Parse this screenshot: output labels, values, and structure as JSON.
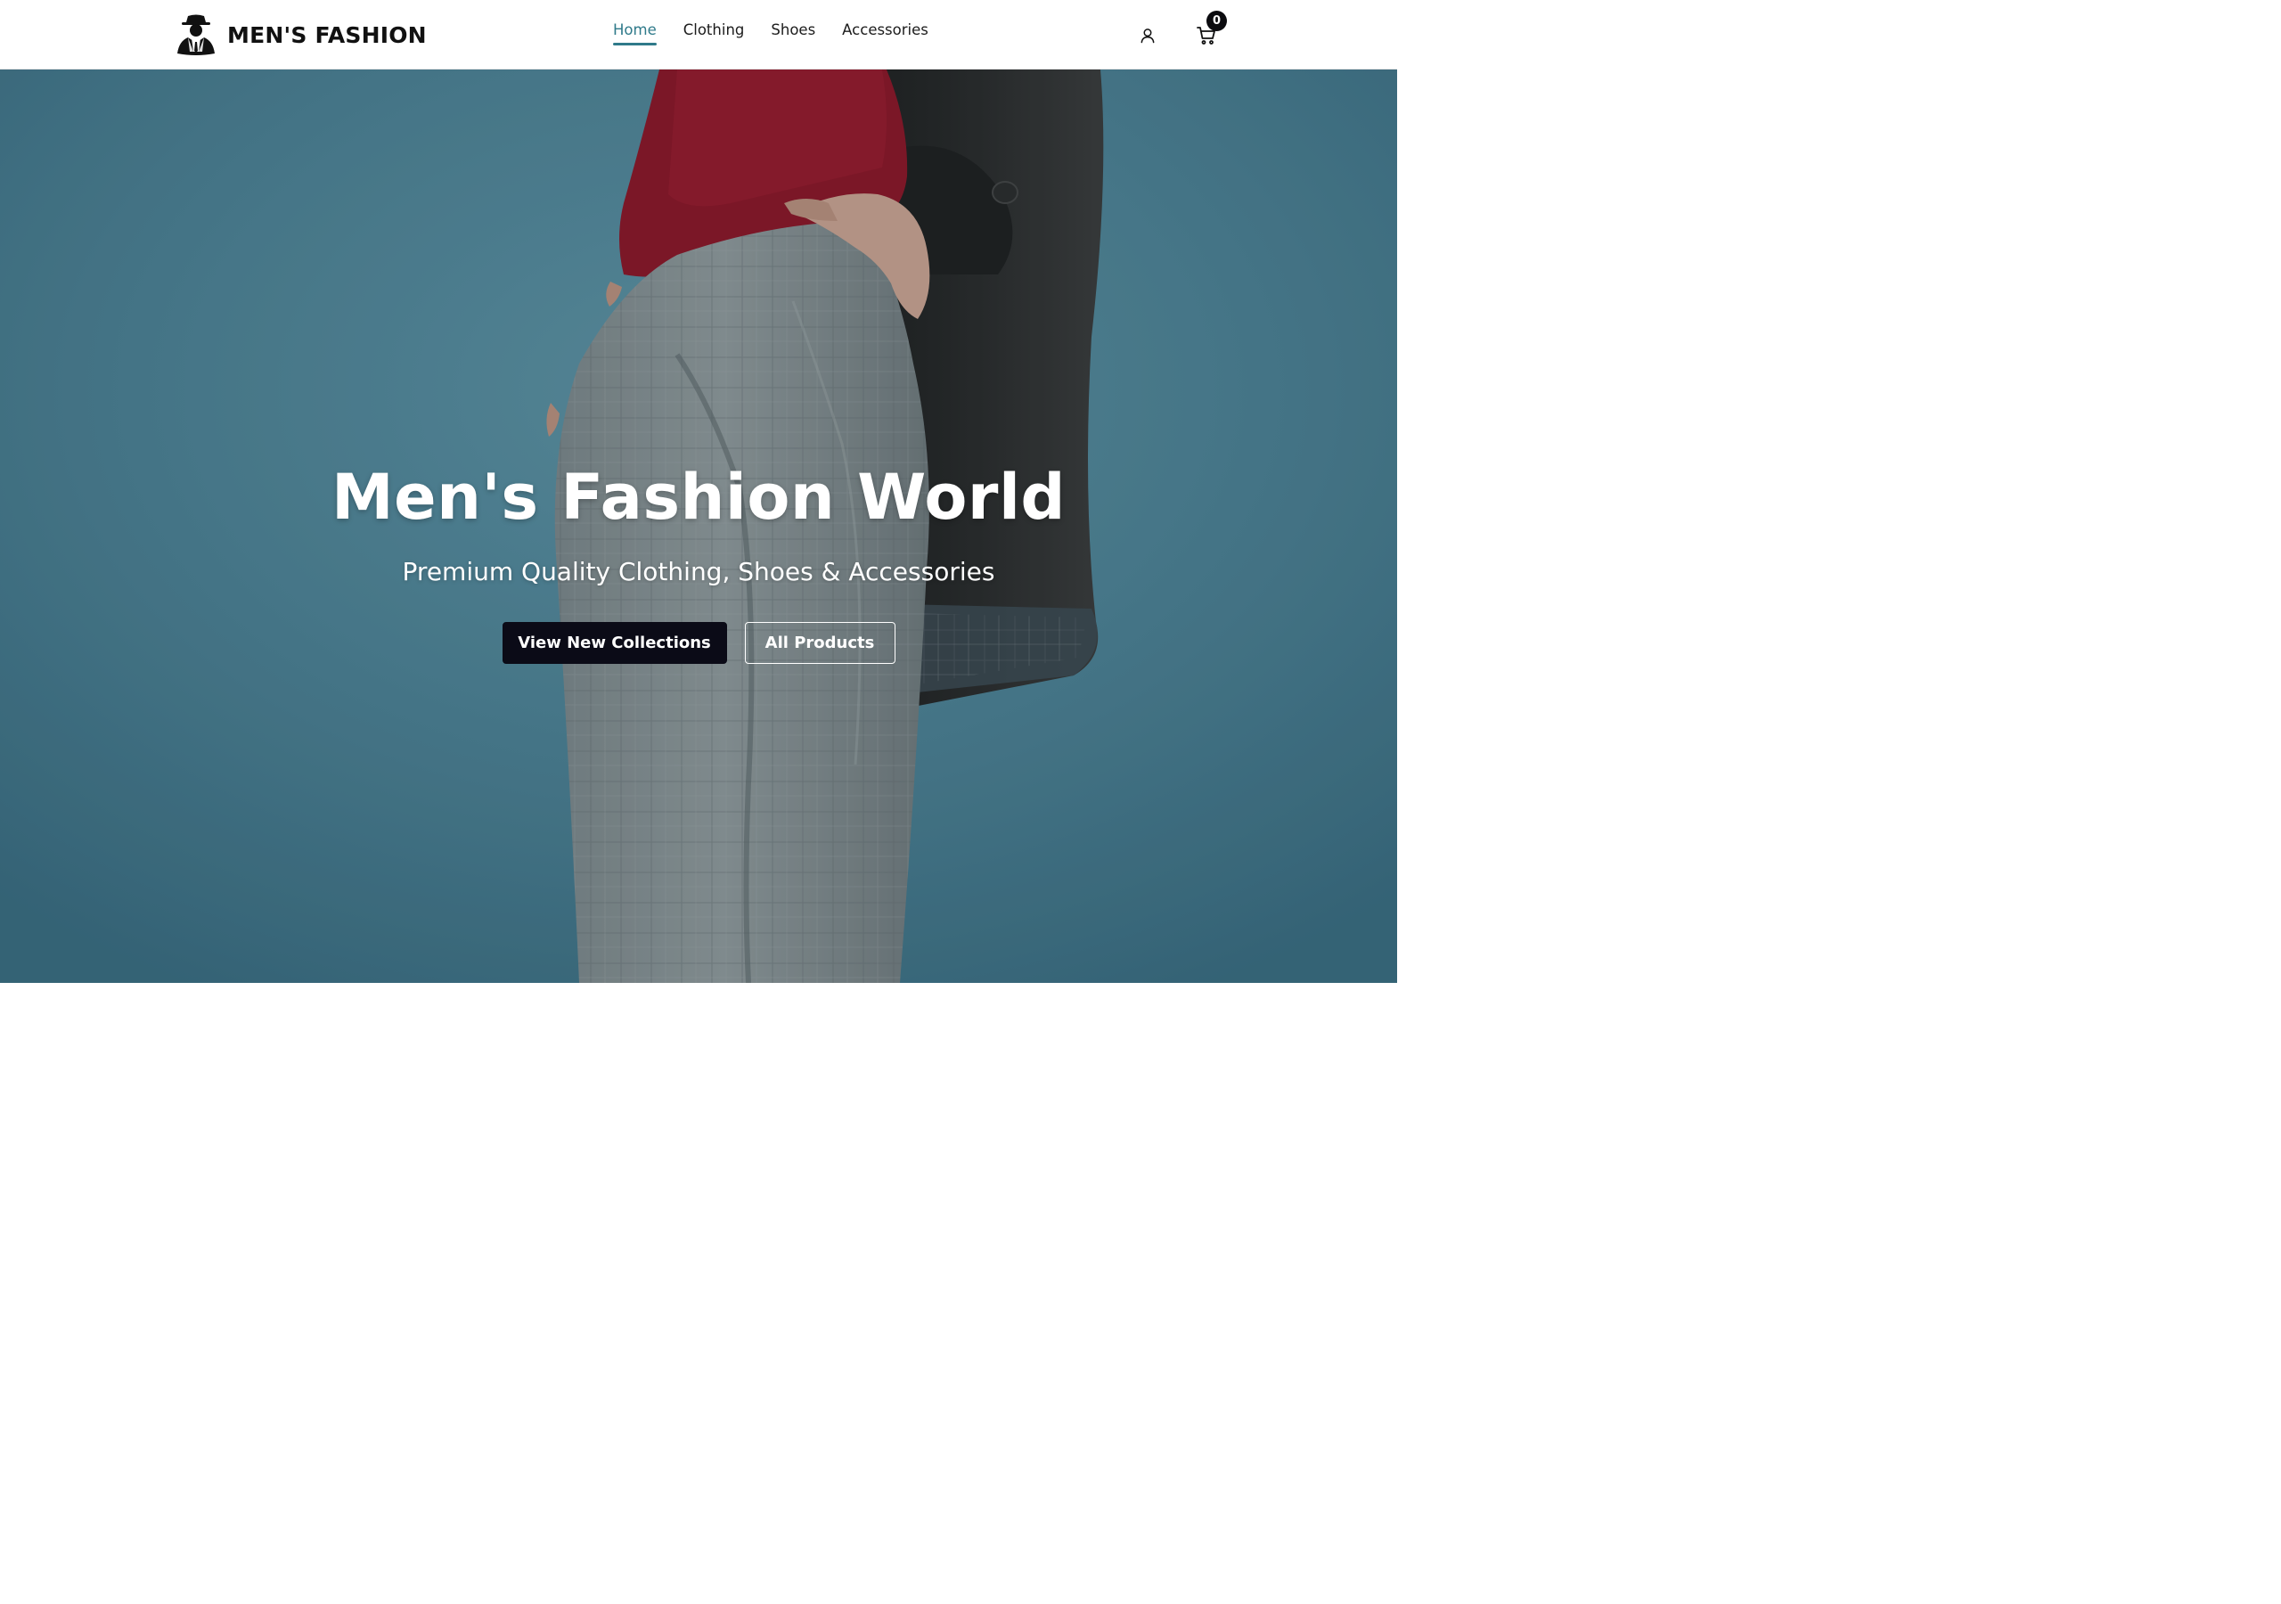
{
  "brand": {
    "name": "MEN'S FASHION",
    "logo_icon": "gentleman-hat-icon"
  },
  "nav": {
    "items": [
      {
        "label": "Home",
        "active": true
      },
      {
        "label": "Clothing",
        "active": false
      },
      {
        "label": "Shoes",
        "active": false
      },
      {
        "label": "Accessories",
        "active": false
      }
    ]
  },
  "header_actions": {
    "user_icon": "user-icon",
    "cart_icon": "cart-icon",
    "cart_count": "0"
  },
  "hero": {
    "title": "Men's Fashion World",
    "subtitle": "Premium Quality Clothing, Shoes & Accessories",
    "primary_button": "View New Collections",
    "secondary_button": "All Products"
  },
  "colors": {
    "accent": "#2f7a8a",
    "hero_background": "#4a7d90",
    "primary_button": "#0b0b17",
    "text_dark": "#111111"
  }
}
